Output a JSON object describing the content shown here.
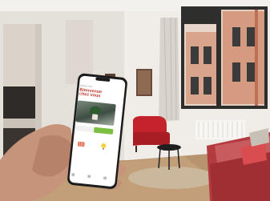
{
  "scene": {
    "subject": "hand holding smartphone in living room"
  },
  "phone": {
    "greeting": "Bonjour Paul",
    "title_line1": "Bienvenue",
    "title_line2": "chez vous"
  },
  "colors": {
    "accent_red": "#c0392b",
    "accent_green": "#7bc043",
    "wall": "#efece7",
    "floor": "#b89570",
    "armchair": "#c4232b",
    "sofa": "#b33b3f"
  },
  "icons": [
    "heater-icon",
    "lightbulb-icon",
    "home-icon"
  ]
}
